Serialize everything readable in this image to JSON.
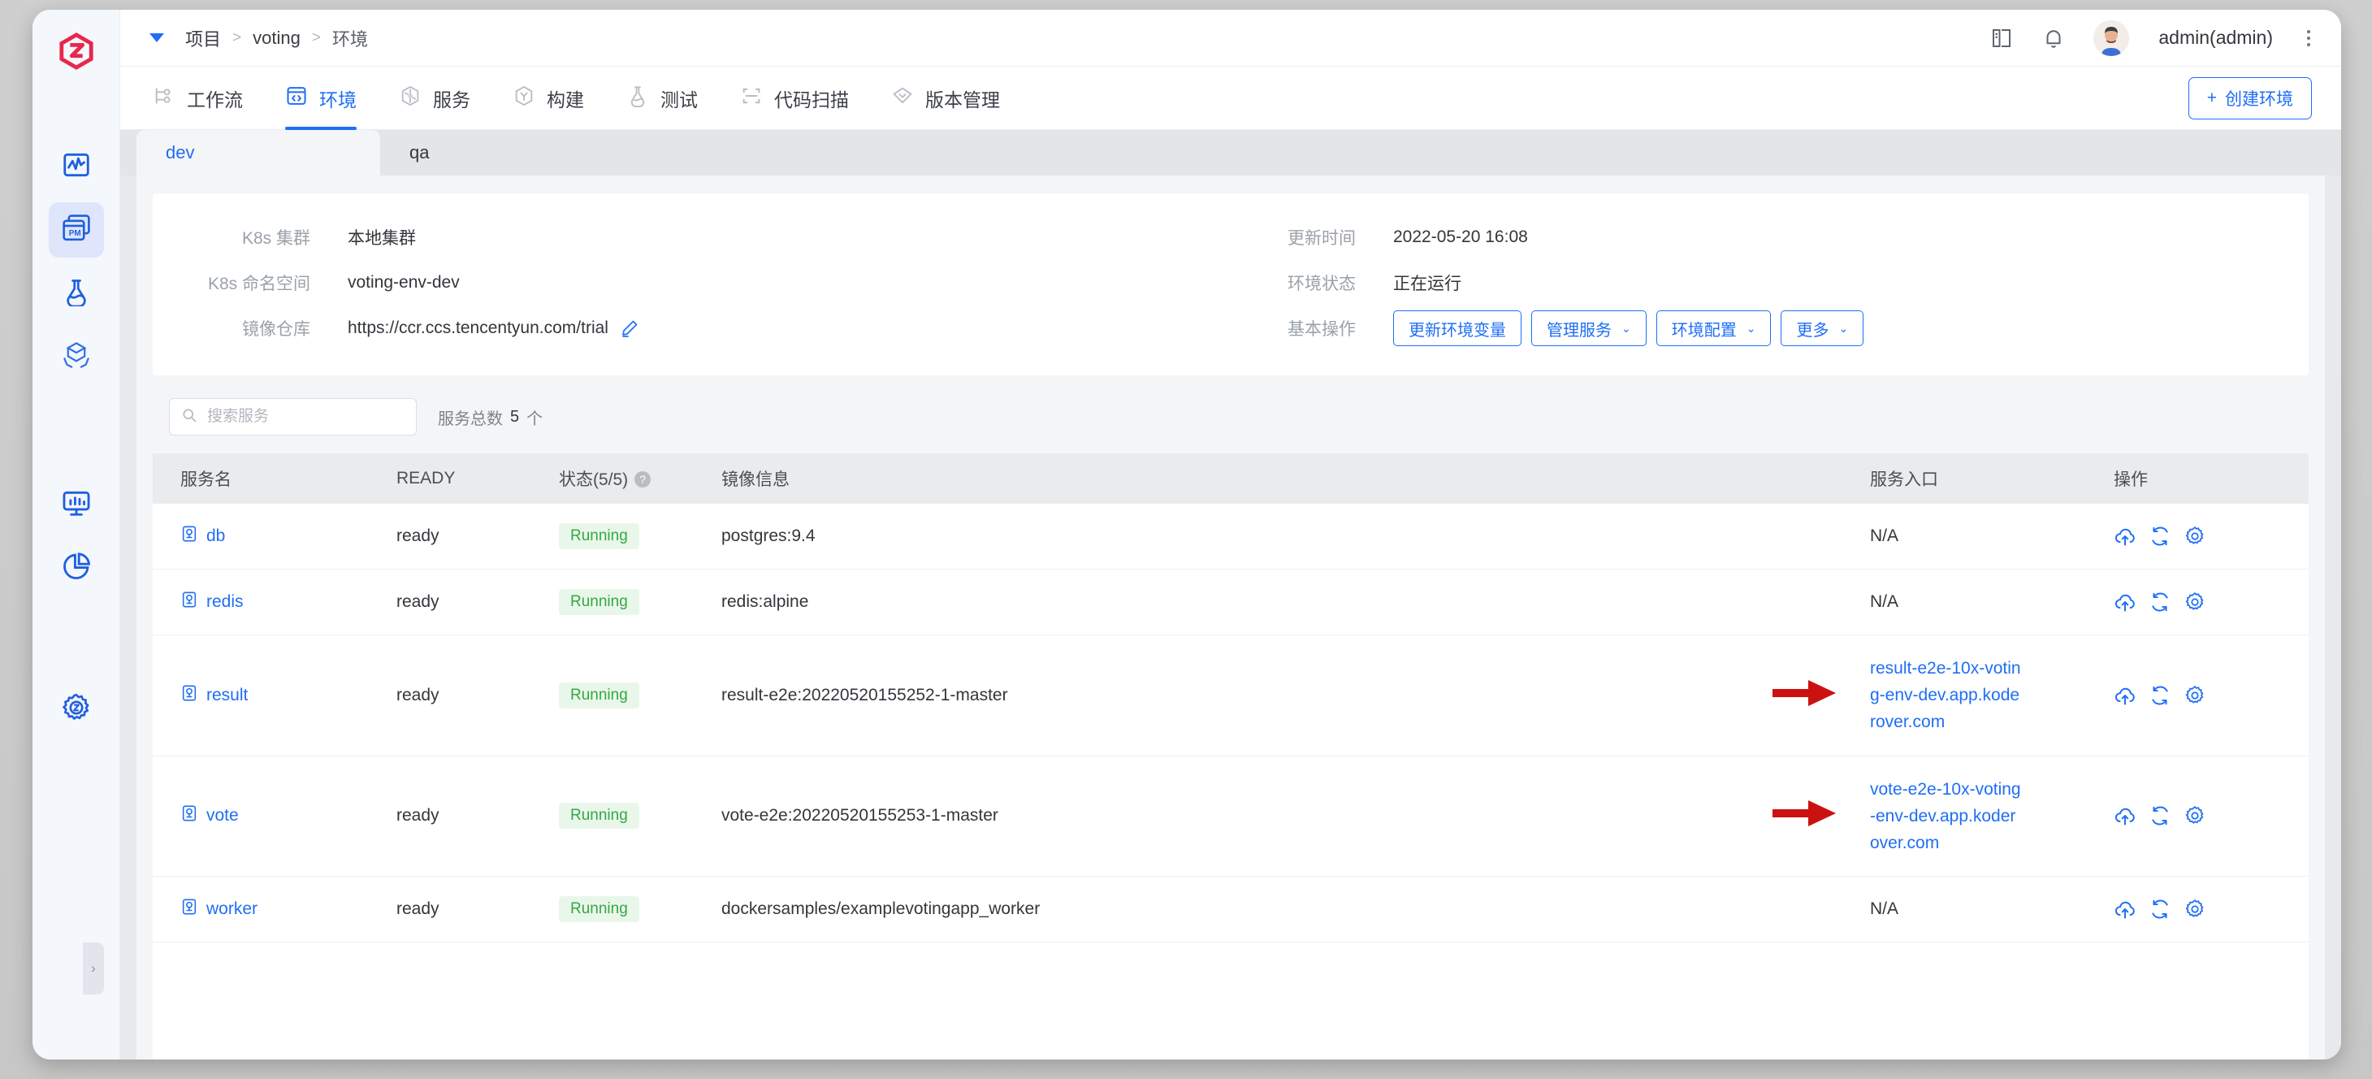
{
  "rail": {
    "logo_name": "koderover-logo",
    "items": [
      {
        "name": "monitor-pulse-icon",
        "label": "监控",
        "active": false
      },
      {
        "name": "pm-window-icon",
        "label": "项目管理",
        "active": true
      },
      {
        "name": "flask-icon",
        "label": "测试",
        "active": false
      },
      {
        "name": "package-delivery-icon",
        "label": "交付",
        "active": false
      },
      {
        "name": "dashboard-chart-icon",
        "label": "数据视图",
        "active": false
      },
      {
        "name": "pie-chart-icon",
        "label": "统计",
        "active": false
      },
      {
        "name": "settings-gear-icon",
        "label": "系统设置",
        "active": false
      }
    ],
    "collapse_handle": "›"
  },
  "topbar": {
    "breadcrumb": [
      "项目",
      "voting",
      "环境"
    ],
    "separator": ">",
    "doc_icon": "book-icon",
    "bell_icon": "bell-icon",
    "avatar_glyph": "🧑",
    "username": "admin(admin)",
    "kebab": "more-vertical-icon"
  },
  "nav": {
    "tabs": [
      {
        "label": "工作流",
        "icon": "workflow-icon",
        "active": false
      },
      {
        "label": "环境",
        "icon": "code-window-icon",
        "active": true
      },
      {
        "label": "服务",
        "icon": "service-node-icon",
        "active": false
      },
      {
        "label": "构建",
        "icon": "build-icon",
        "active": false
      },
      {
        "label": "测试",
        "icon": "flask-icon",
        "active": false
      },
      {
        "label": "代码扫描",
        "icon": "scan-icon",
        "active": false
      },
      {
        "label": "版本管理",
        "icon": "diamond-icon",
        "active": false
      }
    ],
    "create_button": "创建环境",
    "create_plus": "+"
  },
  "env_tabs": [
    {
      "label": "dev",
      "active": true
    },
    {
      "label": "qa",
      "active": false
    }
  ],
  "info": {
    "left": [
      {
        "label": "K8s 集群",
        "value": "本地集群"
      },
      {
        "label": "K8s 命名空间",
        "value": "voting-env-dev"
      },
      {
        "label": "镜像仓库",
        "value": "https://ccr.ccs.tencentyun.com/trial",
        "edit_icon": "pencil-icon"
      }
    ],
    "right": [
      {
        "label": "更新时间",
        "value": "2022-05-20 16:08"
      },
      {
        "label": "环境状态",
        "value": "正在运行"
      }
    ],
    "ops_label": "基本操作",
    "ops_buttons": [
      {
        "label": "更新环境变量",
        "caret": false
      },
      {
        "label": "管理服务",
        "caret": true
      },
      {
        "label": "环境配置",
        "caret": true
      },
      {
        "label": "更多",
        "caret": true
      }
    ]
  },
  "toolbar": {
    "search_placeholder": "搜索服务",
    "search_value": "",
    "search_icon": "search-icon",
    "count_label": "服务总数",
    "count_value": "5",
    "count_unit": "个"
  },
  "table": {
    "columns": [
      "服务名",
      "READY",
      "状态(5/5)",
      "镜像信息",
      "服务入口",
      "操作"
    ],
    "help_icon": "?",
    "action_icons": [
      "cloud-upload-icon",
      "restart-icon",
      "gear-icon"
    ],
    "rows": [
      {
        "name": "db",
        "ready": "ready",
        "status": "Running",
        "image": "postgres:9.4",
        "entry": "N/A",
        "entry_is_link": false,
        "arrow": false
      },
      {
        "name": "redis",
        "ready": "ready",
        "status": "Running",
        "image": "redis:alpine",
        "entry": "N/A",
        "entry_is_link": false,
        "arrow": false
      },
      {
        "name": "result",
        "ready": "ready",
        "status": "Running",
        "image": "result-e2e:20220520155252-1-master",
        "entry": "result-e2e-10x-voting-env-dev.app.koderover.com",
        "entry_is_link": true,
        "arrow": true
      },
      {
        "name": "vote",
        "ready": "ready",
        "status": "Running",
        "image": "vote-e2e:20220520155253-1-master",
        "entry": "vote-e2e-10x-voting-env-dev.app.koderover.com",
        "entry_is_link": true,
        "arrow": true
      },
      {
        "name": "worker",
        "ready": "ready",
        "status": "Running",
        "image": "dockersamples/examplevotingapp_worker",
        "entry": "N/A",
        "entry_is_link": false,
        "arrow": false
      }
    ]
  },
  "colors": {
    "accent": "#1f6ef5",
    "logo_red": "#e8274b",
    "running_green": "#36a745",
    "running_bg": "#e9f7ea",
    "arrow_red": "#cc1111"
  }
}
